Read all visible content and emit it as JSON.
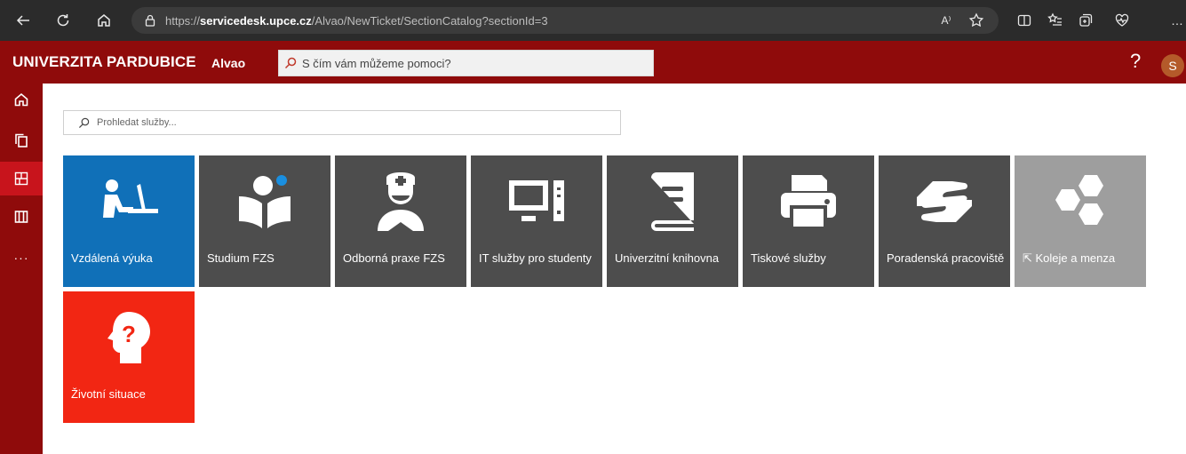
{
  "browser": {
    "url_prefix": "https://",
    "url_host": "servicedesk.upce.cz",
    "url_path": "/Alvao/NewTicket/SectionCatalog?sectionId=3",
    "read_aloud_label": "A⁾"
  },
  "header": {
    "brand": "UNIVERZITA PARDUBICE",
    "app_name": "Alvao",
    "search_placeholder": "S čím vám můžeme pomoci?",
    "help_label": "?",
    "avatar_initial": "S"
  },
  "sidebar": {
    "items": [
      {
        "name": "home",
        "icon": "home-icon"
      },
      {
        "name": "tickets",
        "icon": "copy-icon"
      },
      {
        "name": "catalog",
        "icon": "catalog-icon",
        "active": true
      },
      {
        "name": "knowledge",
        "icon": "book-icon"
      },
      {
        "name": "more",
        "icon": "more-icon",
        "label": "···"
      }
    ]
  },
  "main": {
    "search_placeholder": "Prohledat služby...",
    "tiles": [
      {
        "label": "Vzdálená výuka",
        "icon": "distance-learning-icon",
        "color": "#1070b8"
      },
      {
        "label": "Studium FZS",
        "icon": "study-icon",
        "color": "#4d4d4d"
      },
      {
        "label": "Odborná praxe FZS",
        "icon": "nurse-icon",
        "color": "#4d4d4d"
      },
      {
        "label": "IT služby pro studenty",
        "icon": "computer-icon",
        "color": "#4d4d4d"
      },
      {
        "label": "Univerzitní knihovna",
        "icon": "library-book-icon",
        "color": "#4d4d4d"
      },
      {
        "label": "Tiskové služby",
        "icon": "printer-icon",
        "color": "#4d4d4d"
      },
      {
        "label": "Poradenská pracoviště",
        "icon": "helping-hand-icon",
        "color": "#4d4d4d"
      },
      {
        "label": "⇱ Koleje a menza",
        "icon": "hexagons-icon",
        "color": "#9e9e9e"
      },
      {
        "label": "Životní situace",
        "icon": "question-head-icon",
        "color": "#f22613"
      }
    ]
  }
}
